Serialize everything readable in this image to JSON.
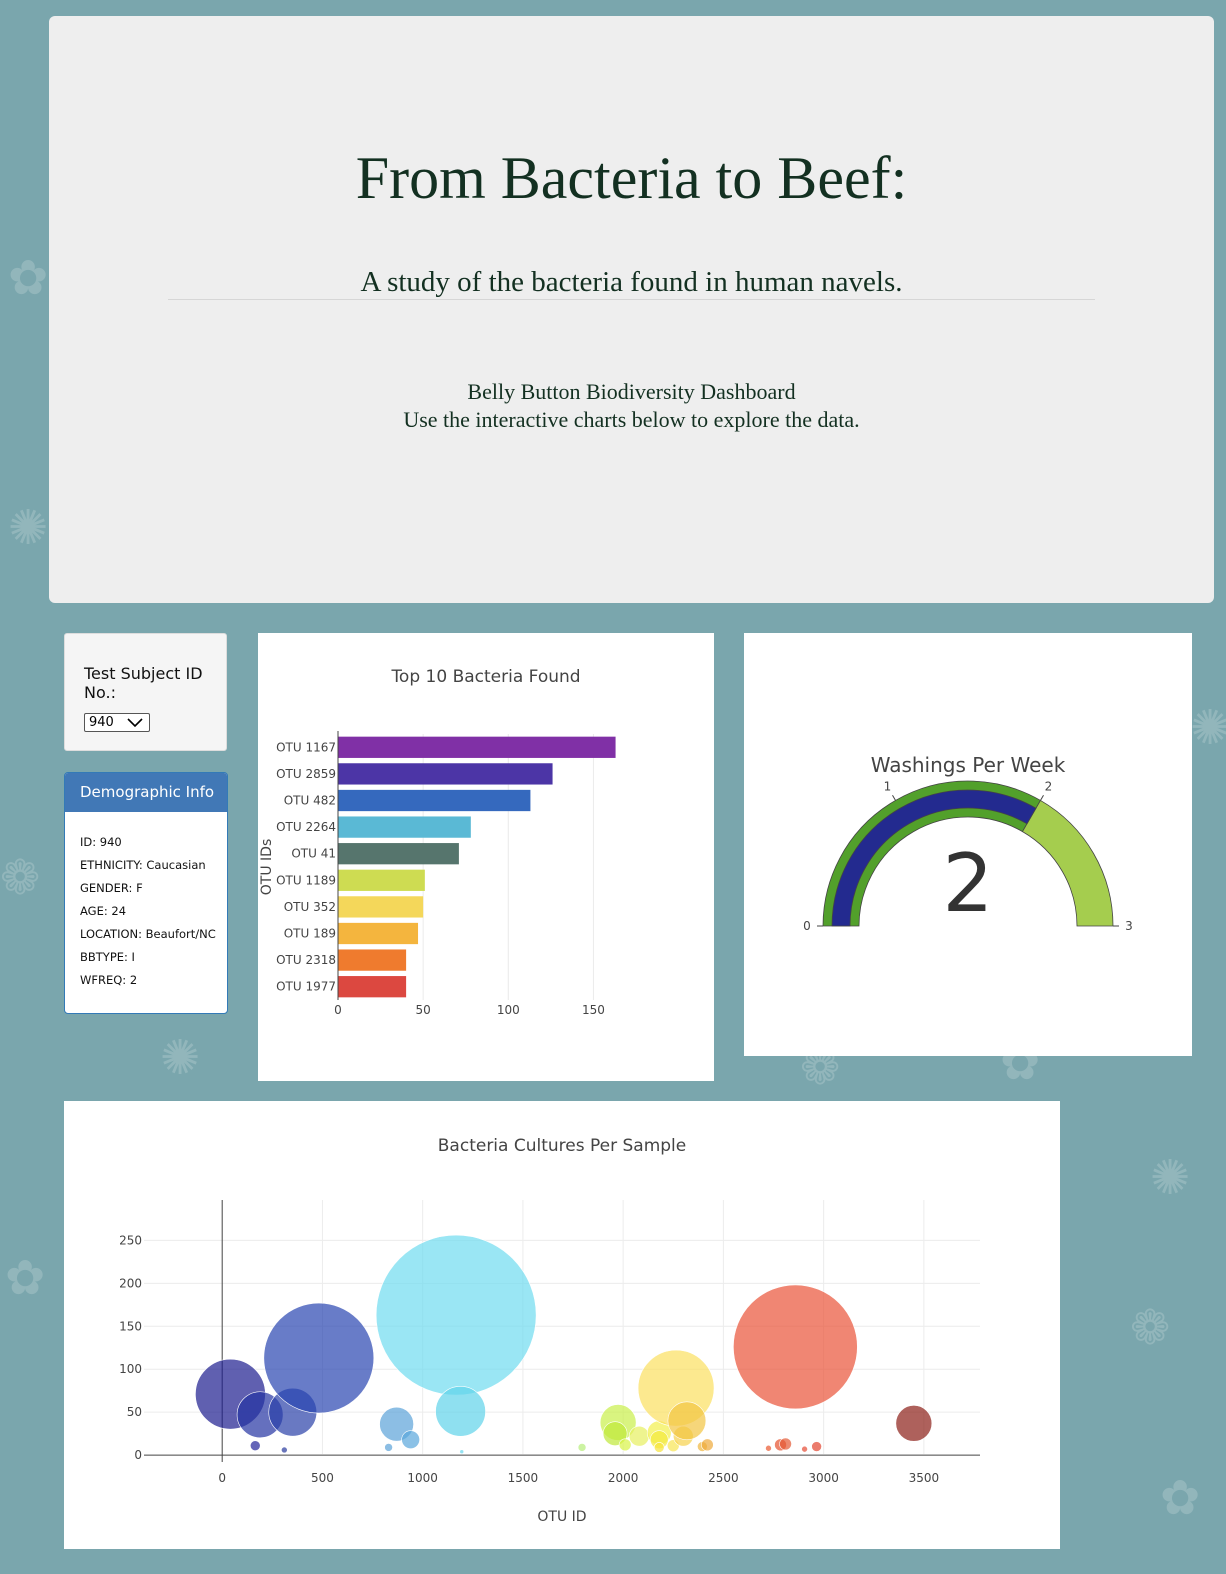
{
  "header": {
    "title": "From Bacteria to Beef:",
    "subtitle": "A study of the bacteria found in human navels.",
    "dashboard_title": "Belly Button Biodiversity Dashboard",
    "dashboard_hint": "Use the interactive charts below to explore the data."
  },
  "selector": {
    "label": "Test Subject ID No.:",
    "selected": "940"
  },
  "demographics": {
    "title": "Demographic Info",
    "rows": [
      "ID: 940",
      "ETHNICITY: Caucasian",
      "GENDER: F",
      "AGE: 24",
      "LOCATION: Beaufort/NC",
      "BBTYPE: I",
      "WFREQ: 2"
    ]
  },
  "gauge_value_display": "2",
  "chart_data": [
    {
      "type": "bar",
      "orientation": "horizontal",
      "title": "Top 10 Bacteria Found",
      "ylabel": "OTU IDs",
      "xlabel": "",
      "categories": [
        "OTU 1167",
        "OTU 2859",
        "OTU 482",
        "OTU 2264",
        "OTU 41",
        "OTU 1189",
        "OTU 352",
        "OTU 189",
        "OTU 2318",
        "OTU 1977"
      ],
      "values": [
        163,
        126,
        113,
        78,
        71,
        51,
        50,
        47,
        40,
        40
      ],
      "colors": [
        "#8030a6",
        "#4c35a6",
        "#3569be",
        "#5ab9d5",
        "#56756d",
        "#cedc52",
        "#f4d75a",
        "#f4b53e",
        "#ef7b2e",
        "#dc4840"
      ],
      "xticks": [
        0,
        50,
        100,
        150
      ],
      "xlim": [
        0,
        175
      ],
      "grid": true
    },
    {
      "type": "gauge",
      "title": "Washings Per Week",
      "value": 2,
      "range": [
        0,
        3
      ],
      "ticks": [
        0,
        1,
        2,
        3
      ],
      "bar_color": "#232a8f",
      "colors": {
        "fill": "#52a02b",
        "upper_step": "#a5cd4e"
      }
    },
    {
      "type": "scatter",
      "subtype": "bubble",
      "title": "Bacteria Cultures Per Sample",
      "xlabel": "OTU ID",
      "ylabel": "",
      "xlim": [
        -390,
        3780
      ],
      "ylim": [
        -8,
        297
      ],
      "xticks": [
        0,
        500,
        1000,
        1500,
        2000,
        2500,
        3000,
        3500
      ],
      "yticks": [
        0,
        50,
        100,
        150,
        200,
        250
      ],
      "grid": true,
      "points": [
        {
          "x": 41,
          "y": 71,
          "color": "#1d1d8f"
        },
        {
          "x": 189,
          "y": 47,
          "color": "#2433a3"
        },
        {
          "x": 352,
          "y": 50,
          "color": "#2a40a8"
        },
        {
          "x": 482,
          "y": 113,
          "color": "#2844b0"
        },
        {
          "x": 165,
          "y": 11,
          "color": "#22239a"
        },
        {
          "x": 310,
          "y": 6,
          "color": "#2a3a9e"
        },
        {
          "x": 870,
          "y": 36,
          "color": "#5ba2d9"
        },
        {
          "x": 940,
          "y": 18,
          "color": "#5aa6dc"
        },
        {
          "x": 830,
          "y": 9,
          "color": "#5ba2d9"
        },
        {
          "x": 1167,
          "y": 163,
          "color": "#6fdbef"
        },
        {
          "x": 1189,
          "y": 51,
          "color": "#5fd3ea"
        },
        {
          "x": 1195,
          "y": 4,
          "color": "#66d6ec"
        },
        {
          "x": 1795,
          "y": 9,
          "color": "#b6ee7a"
        },
        {
          "x": 1975,
          "y": 38,
          "color": "#c9ef4a"
        },
        {
          "x": 1960,
          "y": 25,
          "color": "#bfe839"
        },
        {
          "x": 2010,
          "y": 12,
          "color": "#d9f346"
        },
        {
          "x": 2080,
          "y": 22,
          "color": "#e7f060"
        },
        {
          "x": 2180,
          "y": 26,
          "color": "#f2f04c"
        },
        {
          "x": 2180,
          "y": 18,
          "color": "#f4ea3f"
        },
        {
          "x": 2180,
          "y": 9,
          "color": "#f6e43a"
        },
        {
          "x": 2250,
          "y": 11,
          "color": "#f8e552"
        },
        {
          "x": 2264,
          "y": 78,
          "color": "#fbe05f"
        },
        {
          "x": 2300,
          "y": 22,
          "color": "#f7d14c"
        },
        {
          "x": 2318,
          "y": 40,
          "color": "#f2c442"
        },
        {
          "x": 2395,
          "y": 10,
          "color": "#f0b73e"
        },
        {
          "x": 2420,
          "y": 12,
          "color": "#eea93a"
        },
        {
          "x": 2725,
          "y": 8,
          "color": "#e9592f"
        },
        {
          "x": 2785,
          "y": 12,
          "color": "#e6502c"
        },
        {
          "x": 2810,
          "y": 13,
          "color": "#e45a34"
        },
        {
          "x": 2859,
          "y": 126,
          "color": "#ea5238"
        },
        {
          "x": 2905,
          "y": 7,
          "color": "#e64b34"
        },
        {
          "x": 2965,
          "y": 10,
          "color": "#e2442f"
        },
        {
          "x": 3450,
          "y": 37,
          "color": "#8b1e17"
        }
      ],
      "sizes": [
        35,
        23,
        24,
        55,
        5,
        3,
        17,
        9,
        4,
        80,
        25,
        2,
        4,
        18,
        12,
        6,
        10,
        12,
        9,
        5,
        6,
        38,
        10,
        19,
        5,
        6,
        3,
        6,
        6,
        62,
        3,
        5,
        18
      ]
    }
  ]
}
